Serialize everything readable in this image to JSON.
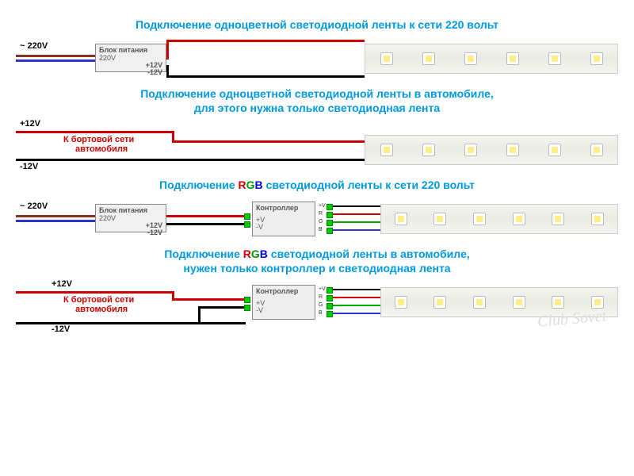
{
  "titles": {
    "t1": "Подключение одноцветной светодиодной ленты к сети 220 вольт",
    "t2a": "Подключение одноцветной светодиодной ленты в автомобиле,",
    "t2b": "для этого нужна только светодиодная лента",
    "t3_pre": "Подключение ",
    "t3_post": " светодиодной ленты к сети 220 вольт",
    "t4a_pre": "Подключение ",
    "t4a_post": " светодиодной ленты в автомобиле,",
    "t4b": "нужен только контроллер и светодиодная лента"
  },
  "rgb": {
    "r": "R",
    "g": "G",
    "b": "B"
  },
  "labels": {
    "v220": "~ 220V",
    "psu_title": "Блок питания",
    "psu_in": "220V",
    "psu_pos": "+12V",
    "psu_neg": "-12V",
    "ctrl_title": "Контроллер",
    "ctrl_vp": "+V",
    "ctrl_vn": "-V",
    "ctrl_out_v": "+V",
    "ctrl_out_r": "R",
    "ctrl_out_g": "G",
    "ctrl_out_b": "B",
    "plus12": "+12V",
    "minus12": "-12V",
    "car_net": "К бортовой сети",
    "car": "автомобиля"
  },
  "watermark": "Club Sovet"
}
